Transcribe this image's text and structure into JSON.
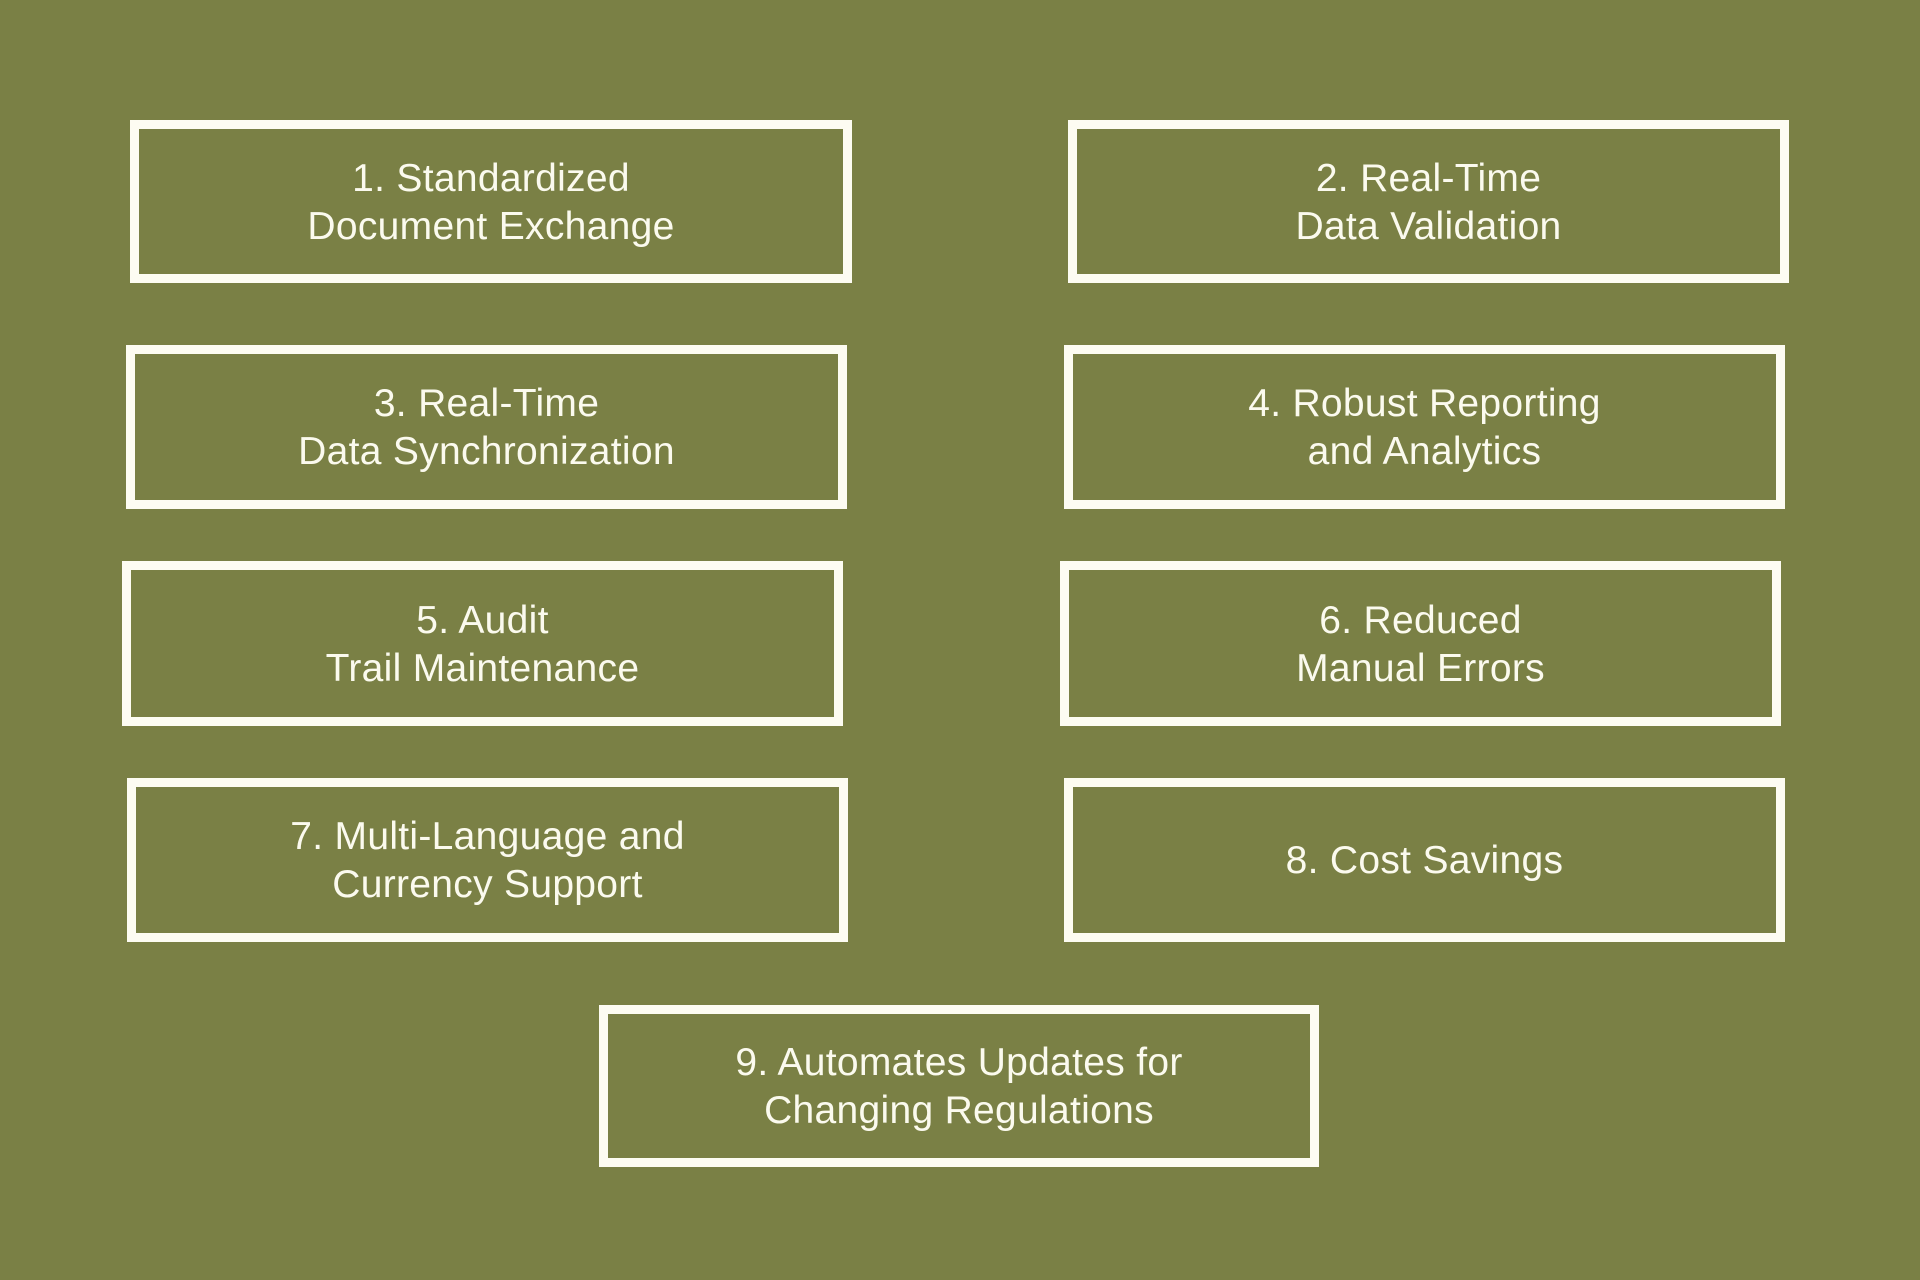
{
  "colors": {
    "background": "#7a8045",
    "box_border": "#fdfcf2",
    "text": "#fbfaee"
  },
  "items": [
    {
      "number": 1,
      "label": "1. Standardized\nDocument Exchange"
    },
    {
      "number": 2,
      "label": "2. Real-Time\nData Validation"
    },
    {
      "number": 3,
      "label": "3. Real-Time\nData Synchronization"
    },
    {
      "number": 4,
      "label": "4. Robust Reporting\nand Analytics"
    },
    {
      "number": 5,
      "label": "5. Audit\nTrail Maintenance"
    },
    {
      "number": 6,
      "label": "6. Reduced\nManual Errors"
    },
    {
      "number": 7,
      "label": "7. Multi-Language and\nCurrency Support"
    },
    {
      "number": 8,
      "label": "8. Cost Savings"
    },
    {
      "number": 9,
      "label": "9. Automates Updates for\nChanging Regulations"
    }
  ]
}
